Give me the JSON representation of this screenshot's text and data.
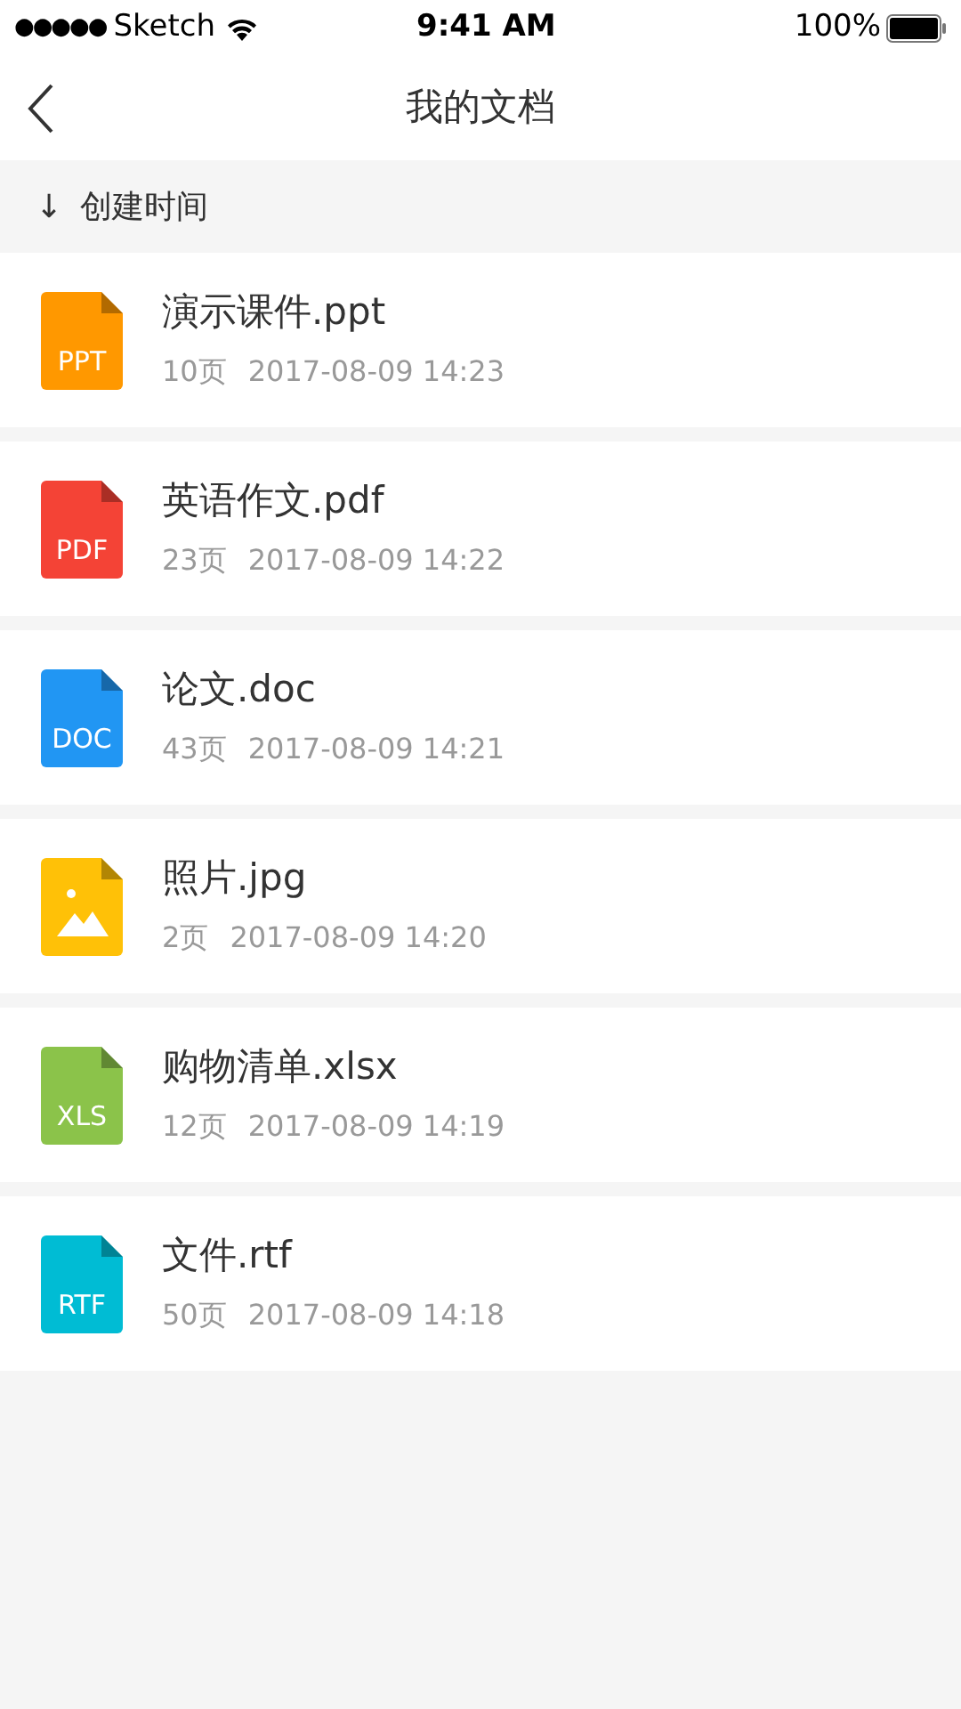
{
  "status_bar": {
    "signal": "●●●●●",
    "carrier": "Sketch",
    "time": "9:41 AM",
    "battery": "100%"
  },
  "nav": {
    "title": "我的文档"
  },
  "sort": {
    "arrow": "↓",
    "label": "创建时间"
  },
  "files": [
    {
      "kind": "doc",
      "badge": "PPT",
      "color": "#ff9800",
      "name": "演示课件.ppt",
      "pages": "10页",
      "date": "2017-08-09 14:23"
    },
    {
      "kind": "doc",
      "badge": "PDF",
      "color": "#f44336",
      "name": "英语作文.pdf",
      "pages": "23页",
      "date": "2017-08-09 14:22"
    },
    {
      "kind": "doc",
      "badge": "DOC",
      "color": "#2196f3",
      "name": "论文.doc",
      "pages": "43页",
      "date": "2017-08-09 14:21"
    },
    {
      "kind": "image",
      "color": "#ffc107",
      "name": "照片.jpg",
      "pages": "2页",
      "date": "2017-08-09 14:20"
    },
    {
      "kind": "doc",
      "badge": "XLS",
      "color": "#8bc34a",
      "name": "购物清单.xlsx",
      "pages": "12页",
      "date": "2017-08-09 14:19"
    },
    {
      "kind": "doc",
      "badge": "RTF",
      "color": "#00bcd4",
      "name": "文件.rtf",
      "pages": "50页",
      "date": "2017-08-09 14:18"
    }
  ]
}
